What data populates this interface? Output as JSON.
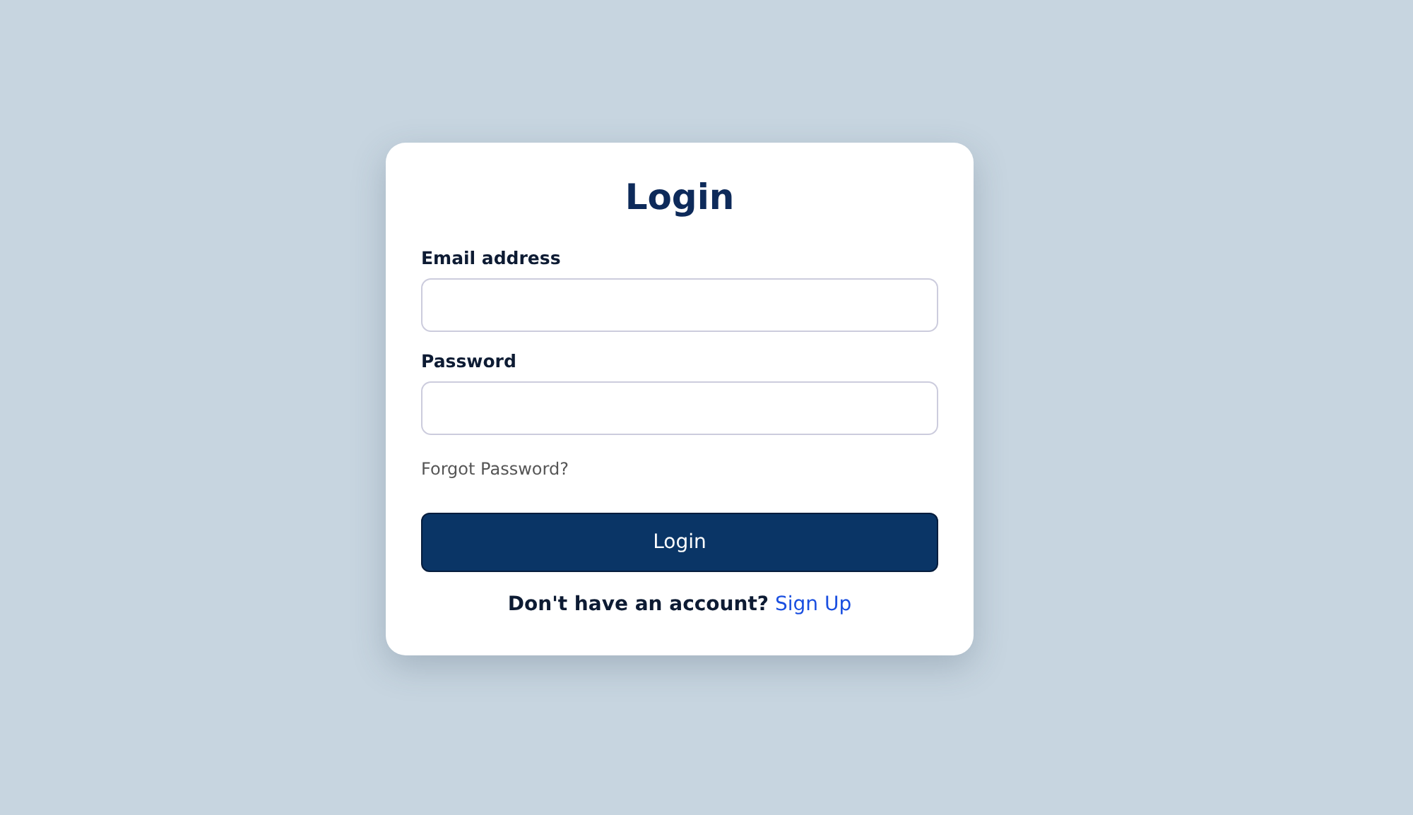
{
  "title": "Login",
  "fields": [
    {
      "label": "Email address"
    },
    {
      "label": "Password"
    }
  ],
  "forgot_link": "Forgot Password?",
  "submit_button": "Login",
  "signup": {
    "prompt": "Don't have an account?",
    "link": "Sign Up"
  }
}
